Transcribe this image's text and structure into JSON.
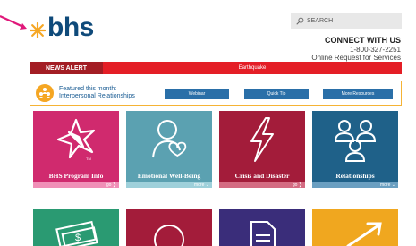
{
  "header": {
    "logo_text": "bhs",
    "search_placeholder": "SEARCH",
    "connect_title": "CONNECT WITH US",
    "connect_phone": "1-800-327-2251",
    "connect_link": "Online Request for Services"
  },
  "news": {
    "label": "NEWS ALERT",
    "item": "Earthquake"
  },
  "featured": {
    "line1": "Featured this month:",
    "line2": "Interpersonal Relationships",
    "buttons": [
      "Webinar",
      "Quick Tip",
      "More Resources"
    ]
  },
  "tiles": [
    {
      "label": "BHS Program Info",
      "more": "go",
      "color": "#d02a6e",
      "strip": "#f08fb7"
    },
    {
      "label": "Emotional Well-Being",
      "more": "more",
      "color": "#5ba1b1",
      "strip": "#9ed0da"
    },
    {
      "label": "Crisis and Disaster",
      "more": "go",
      "color": "#a31c3a",
      "strip": "#d46b82"
    },
    {
      "label": "Relationships",
      "more": "more",
      "color": "#1f6189",
      "strip": "#6a9fc1"
    },
    {
      "color": "#2a9a72"
    },
    {
      "color": "#a31c3a"
    },
    {
      "color": "#3a2d7a"
    },
    {
      "color": "#f0a71f"
    }
  ],
  "icons": {
    "logo": "star-icon",
    "search": "search-icon",
    "featured": "people-icon",
    "tile_icons": [
      "star-icon",
      "person-heart-icon",
      "lightning-icon",
      "people-group-icon",
      "money-icon",
      "circle-icon",
      "document-icon",
      "trend-arrow-icon"
    ]
  }
}
